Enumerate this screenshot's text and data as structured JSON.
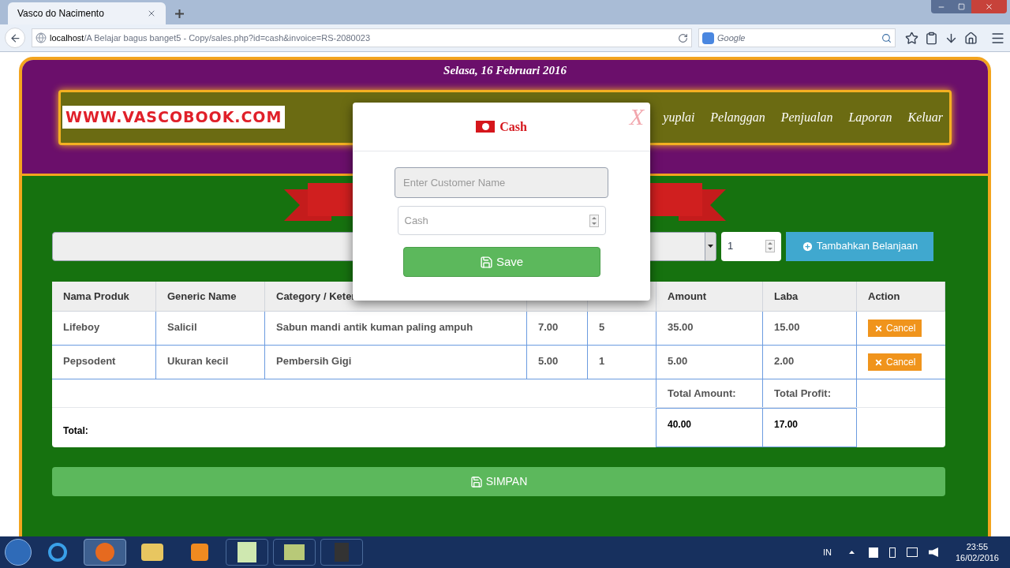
{
  "browser": {
    "tab_title": "Vasco do Nacimento",
    "url_host": "localhost",
    "url_path": "/A Belajar bagus banget5 - Copy/sales.php?id=cash&invoice=RS-2080023",
    "search_placeholder": "Google"
  },
  "page": {
    "date": "Selasa, 16 Februari 2016",
    "logo": "WWW.VASCOBOOK.COM",
    "nav": [
      "yuplai",
      "Pelanggan",
      "Penjualan",
      "Laporan",
      "Keluar"
    ],
    "quantity": "1",
    "add_button": "Tambahkan Belanjaan",
    "table": {
      "columns": [
        "Nama Produk",
        "Generic Name",
        "Category / Keter",
        "",
        "",
        "Amount",
        "Laba",
        "Action"
      ],
      "rows": [
        {
          "cells": [
            "Lifeboy",
            "Salicil",
            "Sabun mandi antik kuman paling ampuh",
            "7.00",
            "5",
            "35.00",
            "15.00"
          ],
          "action": "Cancel"
        },
        {
          "cells": [
            "Pepsodent",
            "Ukuran kecil",
            "Pembersih Gigi",
            "5.00",
            "1",
            "5.00",
            "2.00"
          ],
          "action": "Cancel"
        }
      ],
      "total_amount_label": "Total Amount:",
      "total_profit_label": "Total Profit:",
      "total_label": "Total:",
      "total_amount": "40.00",
      "total_profit": "17.00"
    },
    "save_button": "SIMPAN"
  },
  "modal": {
    "title": "Cash",
    "close": "X",
    "customer_placeholder": "Enter Customer Name",
    "cash_placeholder": "Cash",
    "save_button": "Save"
  },
  "taskbar": {
    "language": "IN",
    "time": "23:55",
    "date": "16/02/2016"
  }
}
